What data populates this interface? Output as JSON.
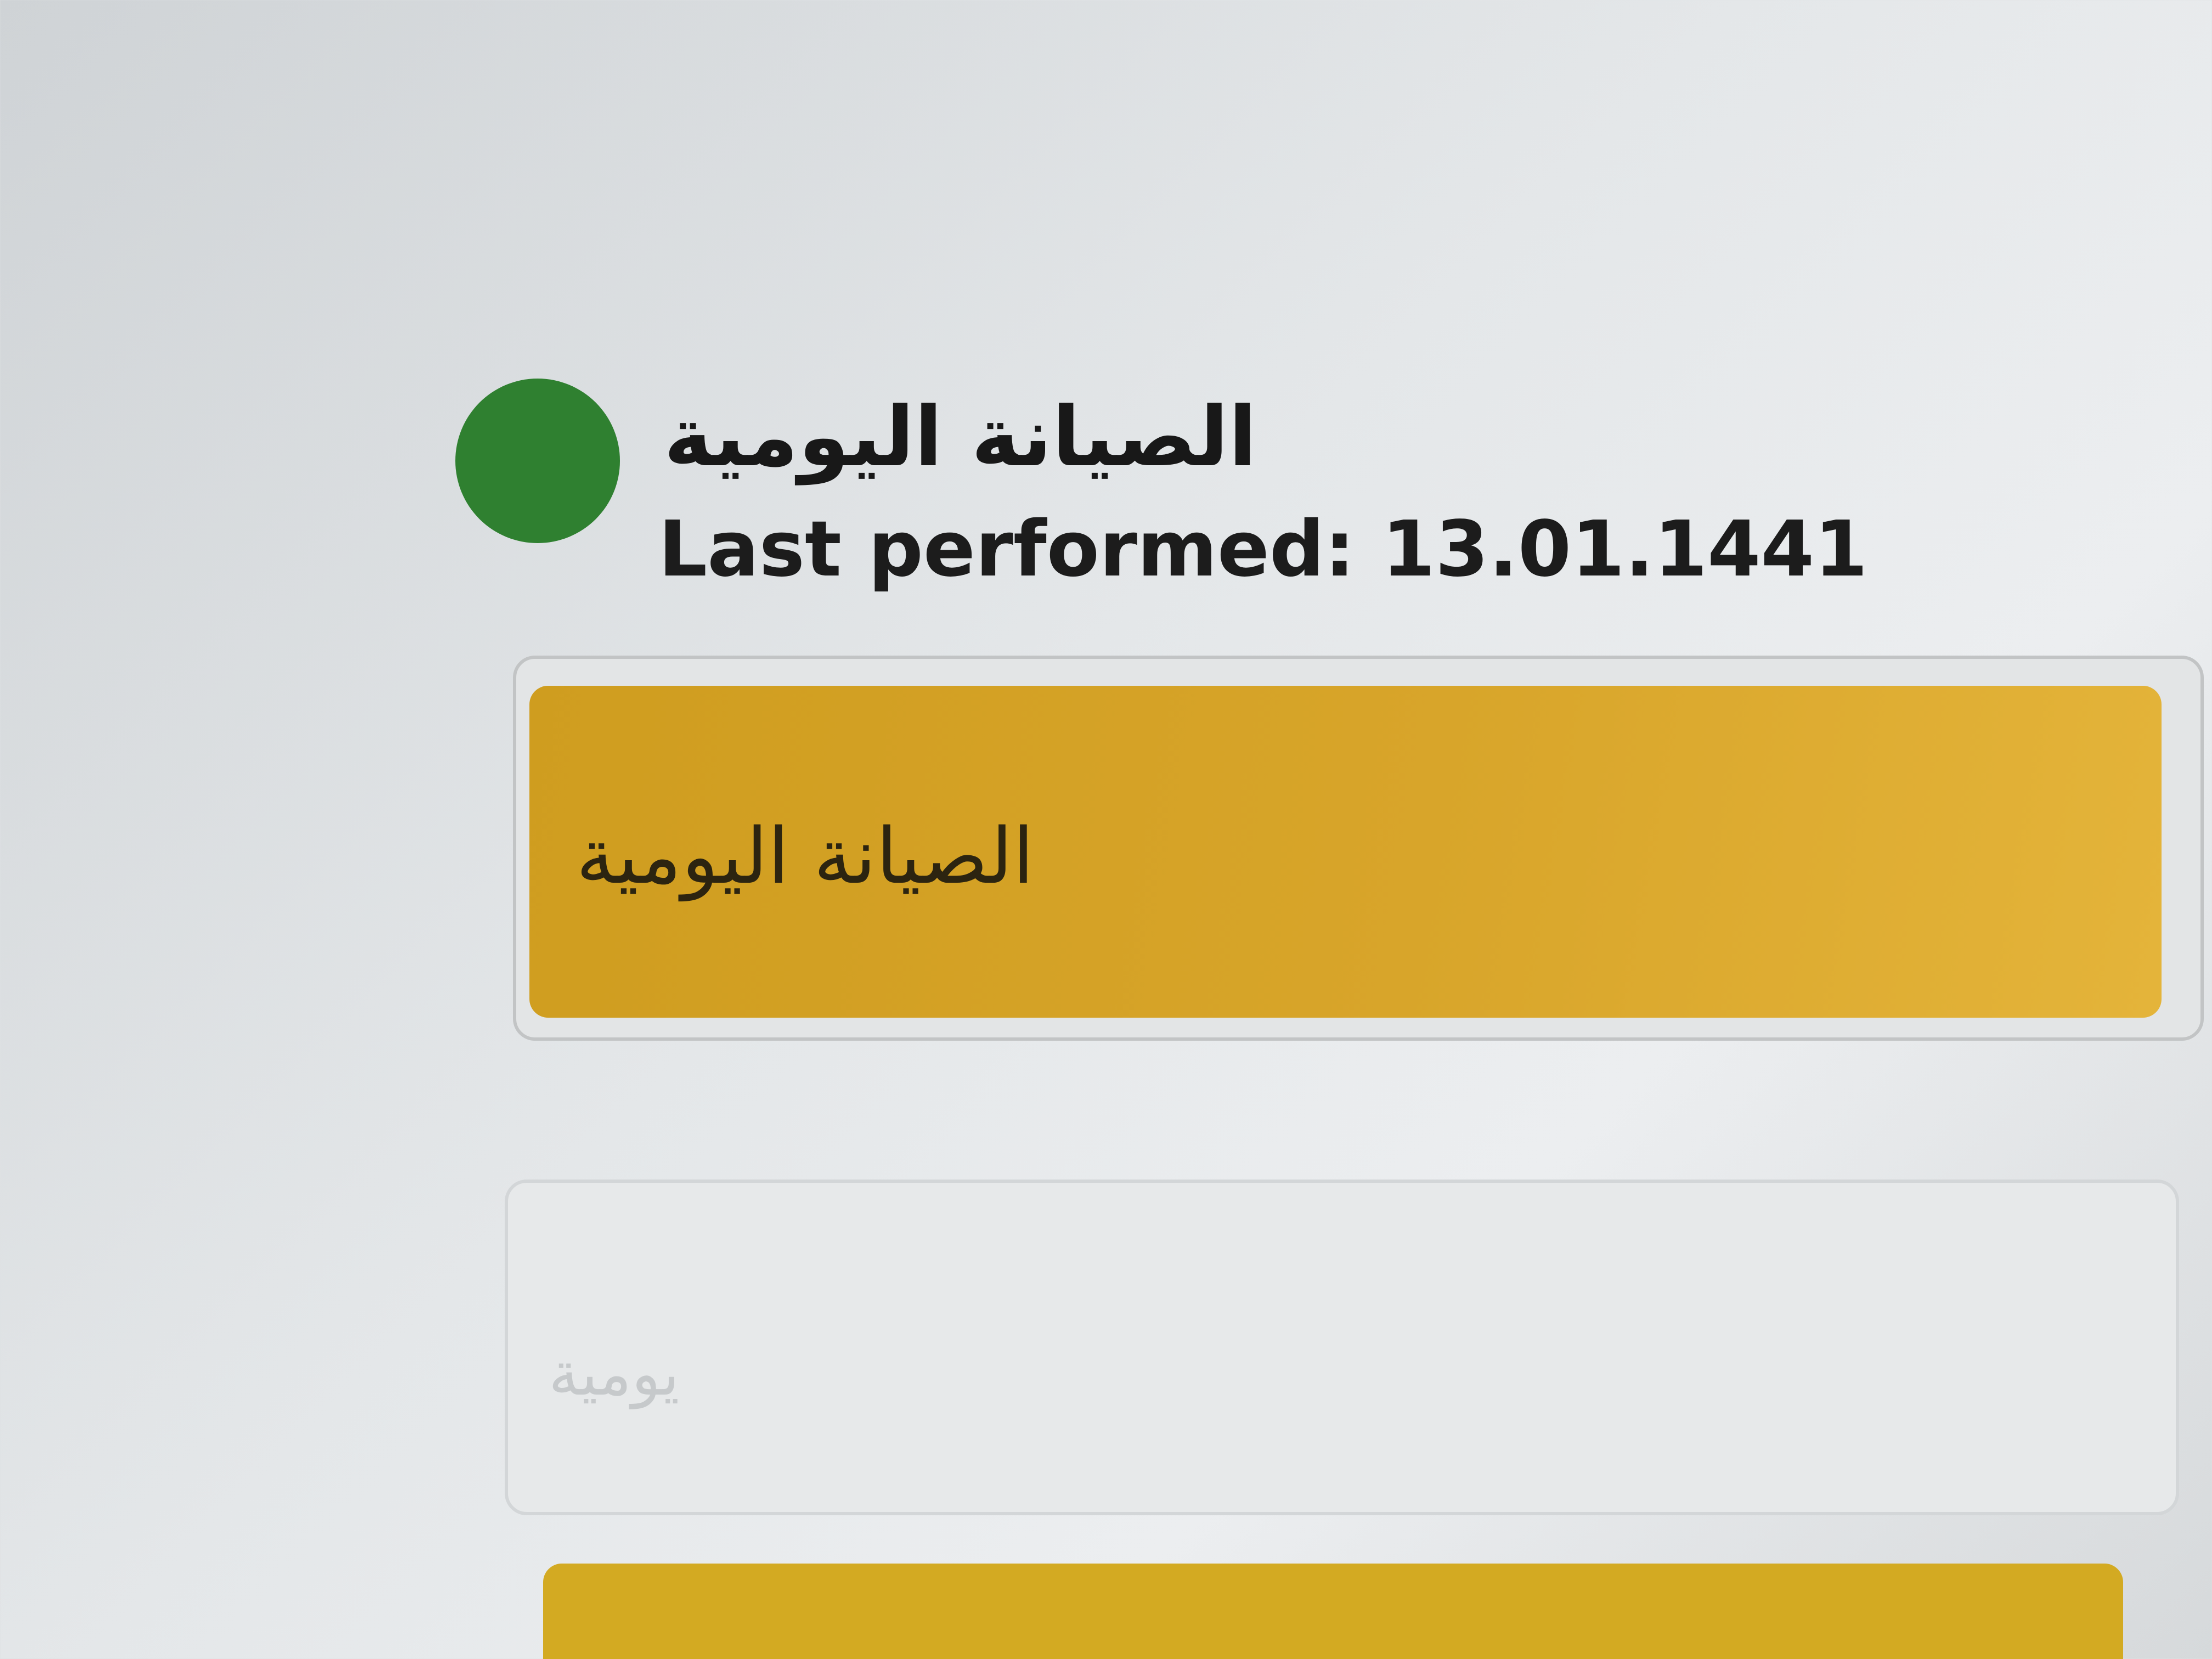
{
  "task": {
    "title": "الصيانة اليومية",
    "last_performed": "Last performed: 13.01.1441",
    "status_color": "#2f8030"
  },
  "action_button": {
    "label": "الصيانة اليومية",
    "color": "#d8a52a"
  },
  "secondary_card": {
    "label": "يومية"
  }
}
